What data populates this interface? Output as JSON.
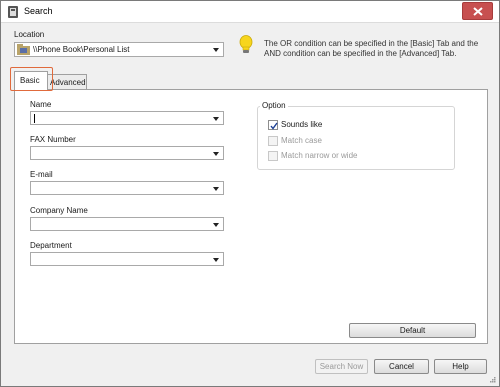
{
  "window": {
    "title": "Search"
  },
  "location": {
    "label": "Location",
    "value": "\\\\Phone Book\\Personal List"
  },
  "info": {
    "text": "The OR condition can be specified in the [Basic] Tab and the AND condition can be specified in the [Advanced] Tab."
  },
  "tabs": [
    {
      "label": "Basic",
      "active": true
    },
    {
      "label": "Advanced",
      "active": false
    }
  ],
  "fields": [
    {
      "label": "Name",
      "value": ""
    },
    {
      "label": "FAX Number",
      "value": ""
    },
    {
      "label": "E-mail",
      "value": ""
    },
    {
      "label": "Company Name",
      "value": ""
    },
    {
      "label": "Department",
      "value": ""
    }
  ],
  "option": {
    "title": "Option",
    "items": [
      {
        "label": "Sounds like",
        "checked": true,
        "enabled": true
      },
      {
        "label": "Match case",
        "checked": false,
        "enabled": false
      },
      {
        "label": "Match narrow or wide",
        "checked": false,
        "enabled": false
      }
    ]
  },
  "buttons": {
    "default": "Default",
    "search_now": "Search Now",
    "cancel": "Cancel",
    "help": "Help"
  },
  "colors": {
    "tab_highlight": "#e06a3c",
    "close_button": "#c75050"
  }
}
